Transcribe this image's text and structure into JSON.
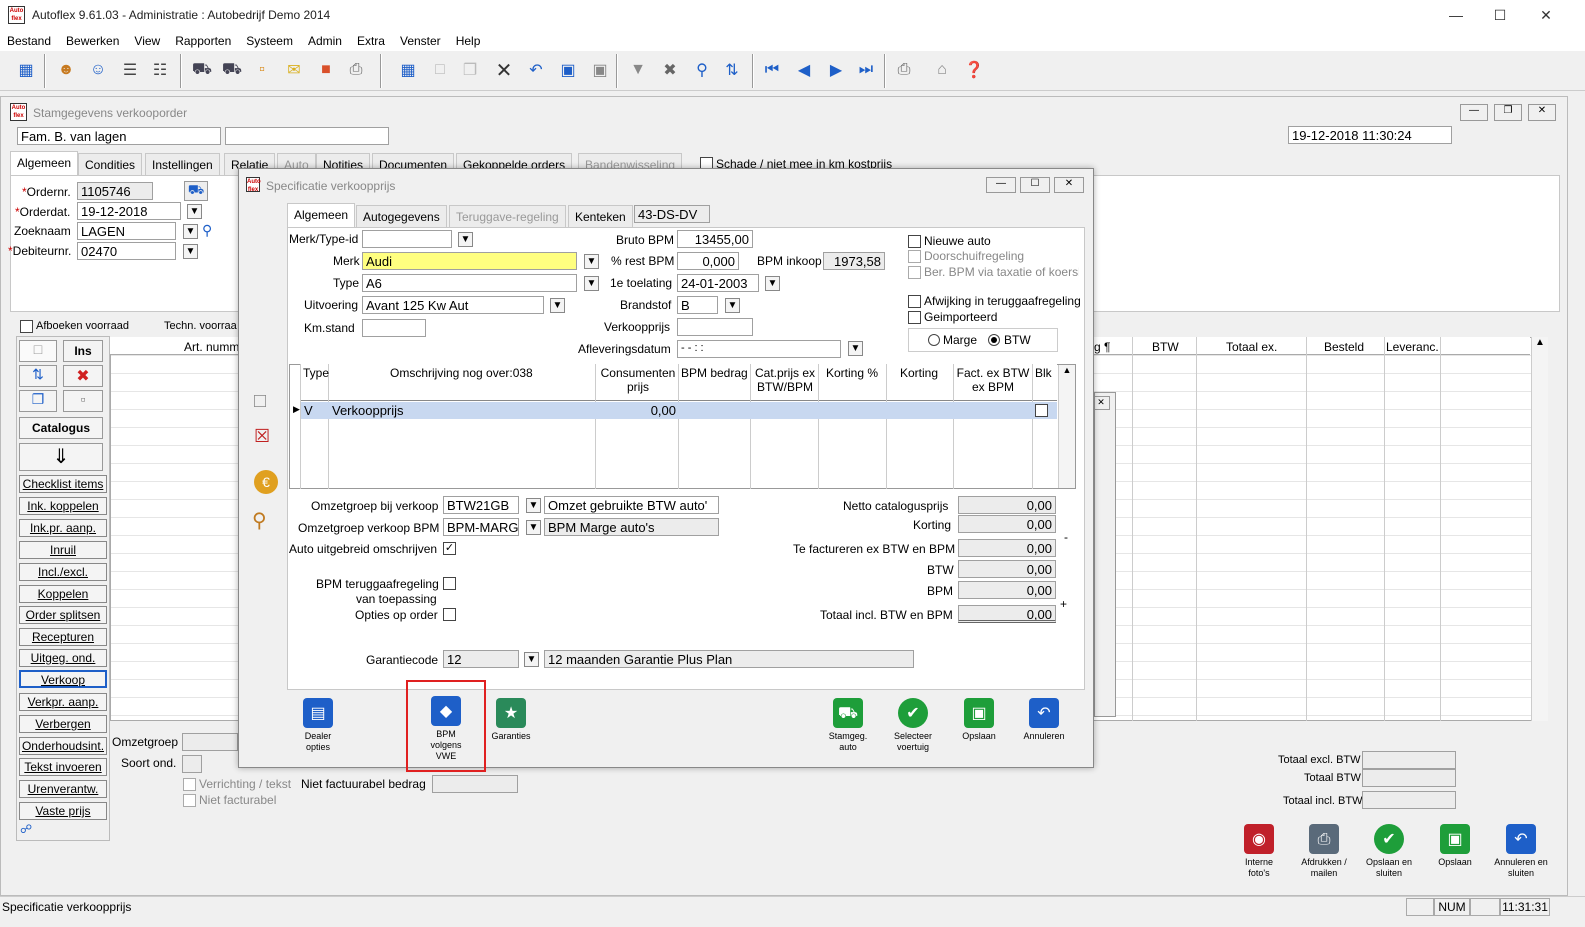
{
  "app": {
    "title": "Autoflex 9.61.03 - Administratie : Autobedrijf Demo 2014",
    "logo": "Auto flex"
  },
  "menu": [
    "Bestand",
    "Bewerken",
    "View",
    "Rapporten",
    "Systeem",
    "Admin",
    "Extra",
    "Venster",
    "Help"
  ],
  "main": {
    "title": "Stamgegevens verkooporder",
    "customer": "Fam. B. van lagen",
    "datetime": "19-12-2018 11:30:24",
    "tabs": [
      "Algemeen",
      "Condities",
      "Instellingen",
      "Relatie",
      "Auto",
      "Notities",
      "Documenten",
      "Gekoppelde orders",
      "Bandenwisseling"
    ],
    "schade_label": "Schade / niet mee in km kostprijs",
    "ordernr_label": "Ordernr.",
    "ordernr": "1105746",
    "orderdat_label": "Orderdat.",
    "orderdat": "19-12-2018",
    "zoeknaam_label": "Zoeknaam",
    "zoeknaam": "LAGEN",
    "debiteurnr_label": "Debiteurnr.",
    "debiteurnr": "02470",
    "afboeken_label": "Afboeken voorraad",
    "techn_label": "Techn. voorraa",
    "grid_cols": {
      "art": "Art. numm",
      "g": "g ¶",
      "btw": "BTW",
      "totaal": "Totaal ex.",
      "besteld": "Besteld",
      "leveranc": "Leveranc."
    },
    "side_ins": "Ins",
    "side_catalogus": "Catalogus",
    "side_buttons": [
      "Checklist items",
      "Ink. koppelen",
      "Ink.pr. aanp.",
      "Inruil",
      "Incl./excl.",
      "Koppelen",
      "Order splitsen",
      "Recepturen",
      "Uitgeg. ond.",
      "Verkoop",
      "Verkpr. aanp.",
      "Verbergen",
      "Onderhoudsint.",
      "Tekst invoeren",
      "Urenverantw.",
      "Vaste prijs"
    ],
    "omzetgroep_label": "Omzetgroep",
    "soort_label": "Soort ond.",
    "verrichting_label": "Verrichting / tekst",
    "niet_fact_label": "Niet facturabel",
    "niet_fact_bedrag": "Niet factuurabel bedrag",
    "tot_excl": "Totaal excl. BTW",
    "tot_btw": "Totaal BTW",
    "tot_incl": "Totaal incl. BTW",
    "bottom_buttons": [
      {
        "label": "Interne foto's",
        "color": "#c0202a"
      },
      {
        "label": "Afdrukken / mailen",
        "color": "#5a6a7a"
      },
      {
        "label": "Opslaan en sluiten",
        "color": "#1e9e3a"
      },
      {
        "label": "Opslaan",
        "color": "#1e9e3a"
      },
      {
        "label": "Annuleren en sluiten",
        "color": "#1e5fc8"
      }
    ]
  },
  "dialog": {
    "title": "Specificatie verkoopprijs",
    "tabs": [
      "Algemeen",
      "Autogegevens",
      "Teruggave-regeling",
      "Kenteken"
    ],
    "kenteken": "43-DS-DV",
    "merktype_label": "Merk/Type-id",
    "merktype": "",
    "merk_label": "Merk",
    "merk": "Audi",
    "type_label": "Type",
    "type": "A6",
    "uitvoering_label": "Uitvoering",
    "uitvoering": "Avant 125 Kw Aut",
    "kmstand_label": "Km.stand",
    "kmstand": "",
    "bruto_label": "Bruto BPM",
    "bruto": "13455,00",
    "rest_label": "% rest BPM",
    "rest": "0,000",
    "inkoop_label": "BPM inkoop",
    "inkoop": "1973,58",
    "toelating_label": "1e toelating",
    "toelating": "24-01-2003",
    "brandstof_label": "Brandstof",
    "brandstof": "B",
    "verkoopprijs_label": "Verkoopprijs",
    "verkoopprijs": "",
    "aflever_label": "Afleveringsdatum",
    "aflever": "-   -        :   :",
    "nieuwe_auto": "Nieuwe auto",
    "doorschuif": "Doorschuifregeling",
    "taxatie": "Ber. BPM via taxatie of koersl",
    "afwijking": "Afwijking in teruggaafregeling",
    "geimporteerd": "Geimporteerd",
    "marge": "Marge",
    "btw": "BTW",
    "cols": {
      "type": "Type",
      "omschr": "Omschrijving nog over:038",
      "cons": "Consumenten prijs",
      "bpm": "BPM bedrag",
      "cat": "Cat.prijs ex BTW/BPM",
      "kortpct": "Korting %",
      "kort": "Korting",
      "fact": "Fact. ex BTW ex BPM",
      "blk": "Blk"
    },
    "row": {
      "type": "V",
      "omschr": "Verkoopprijs",
      "cons": "0,00"
    },
    "omzet_label": "Omzetgroep bij verkoop",
    "omzet_code": "BTW21GB",
    "omzet_desc": "Omzet gebruikte BTW auto'",
    "omzetbpm_label": "Omzetgroep verkoop BPM",
    "omzetbpm_code": "BPM-MARGE",
    "omzetbpm_desc": "BPM Marge auto's",
    "auto_uitgebreid": "Auto uitgebreid omschrijven",
    "bpm_terug1": "BPM teruggaafregeling",
    "bpm_terug2": "van toepassing",
    "opties": "Opties op order",
    "netto_label": "Netto catalogusprijs",
    "netto": "0,00",
    "korting_label": "Korting",
    "korting": "0,00",
    "tefact_label": "Te factureren ex BTW en BPM",
    "tefact": "0,00",
    "btw_label": "BTW",
    "btw_val": "0,00",
    "bpm_label": "BPM",
    "bpm_val": "0,00",
    "totincl_label": "Totaal incl. BTW en BPM",
    "totincl": "0,00",
    "garantie_label": "Garantiecode",
    "garantie_code": "12",
    "garantie_desc": "12 maanden Garantie Plus Plan",
    "btn_dealer": "Dealer opties",
    "btn_bpm": "BPM volgens VWE",
    "btn_garanties": "Garanties",
    "btn_stamgeg": "Stamgeg. auto",
    "btn_selecteer": "Selecteer voertuig",
    "btn_opslaan": "Opslaan",
    "btn_annuleren": "Annuleren"
  },
  "status": {
    "text": "Specificatie verkoopprijs",
    "num": "NUM",
    "time": "11:31:31"
  }
}
